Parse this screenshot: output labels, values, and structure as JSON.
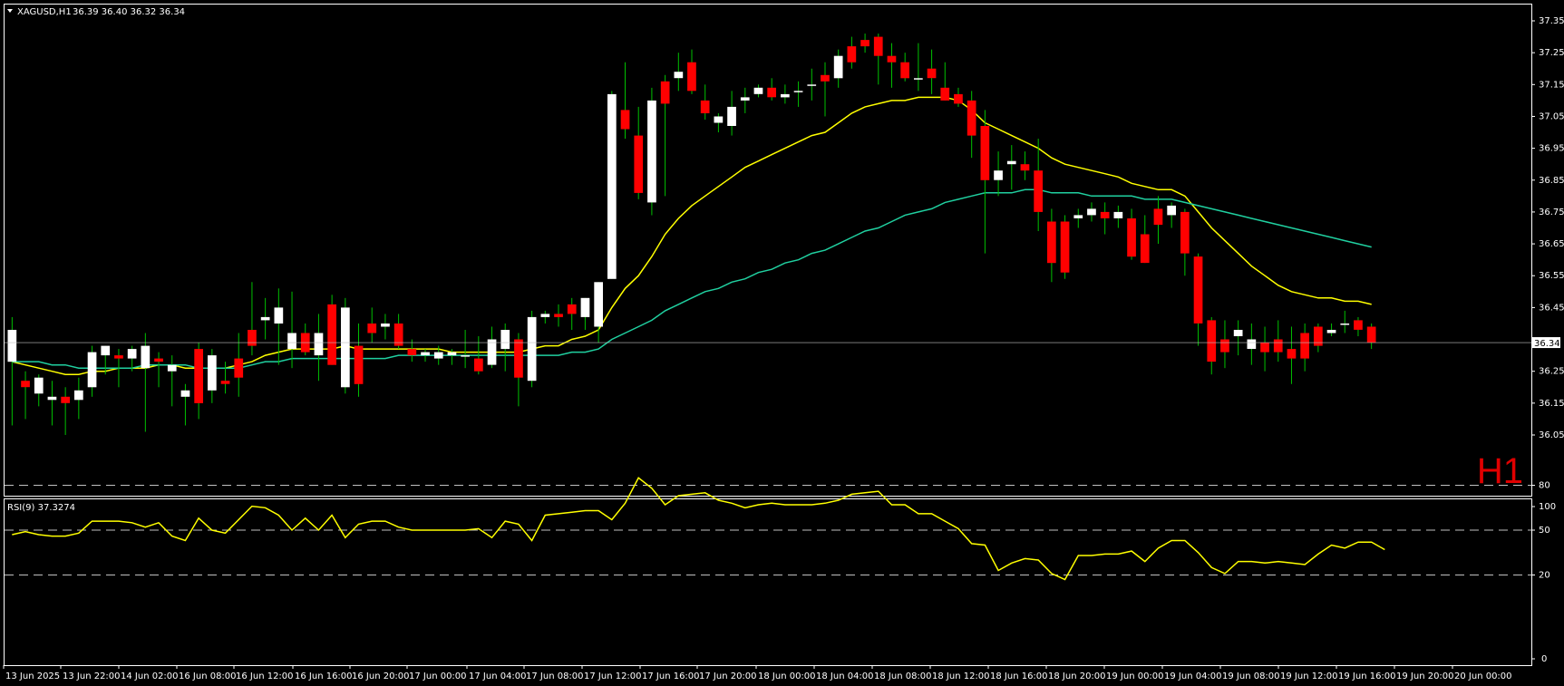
{
  "header": {
    "symbol": "XAGUSD,H1",
    "ohlc": "36.39 36.40 36.32 36.34"
  },
  "timeframe_watermark": "H1",
  "rsi_header": "RSI(9) 37.3274",
  "colors": {
    "background": "#000000",
    "frame": "#ffffff",
    "bull_candle": "#ffffff",
    "bear_candle": "#ff0000",
    "wick": "#00c000",
    "ma_fast": "#ffff00",
    "ma_slow": "#20d0a0",
    "rsi": "#ffff00",
    "watermark": "#e00000"
  },
  "chart_data": [
    {
      "type": "candlestick",
      "title": "XAGUSD,H1",
      "ylim": [
        36.0,
        37.4
      ],
      "yticks": [
        "37.35",
        "37.25",
        "37.15",
        "37.05",
        "36.95",
        "36.85",
        "36.75",
        "36.65",
        "36.55",
        "36.45",
        "36.34",
        "36.25",
        "36.15",
        "36.05"
      ],
      "last_price": "36.34",
      "xticks": [
        "13 Jun 2025",
        "13 Jun 22:00",
        "14 Jun 02:00",
        "16 Jun 08:00",
        "16 Jun 12:00",
        "16 Jun 16:00",
        "16 Jun 20:00",
        "17 Jun 00:00",
        "17 Jun 04:00",
        "17 Jun 08:00",
        "17 Jun 12:00",
        "17 Jun 16:00",
        "17 Jun 20:00",
        "18 Jun 00:00",
        "18 Jun 04:00",
        "18 Jun 08:00",
        "18 Jun 12:00",
        "18 Jun 16:00",
        "18 Jun 20:00",
        "19 Jun 00:00",
        "19 Jun 04:00",
        "19 Jun 08:00",
        "19 Jun 12:00",
        "19 Jun 16:00",
        "19 Jun 20:00",
        "20 Jun 00:00"
      ],
      "candles": [
        [
          36.28,
          36.42,
          36.08,
          36.38
        ],
        [
          36.22,
          36.25,
          36.1,
          36.2
        ],
        [
          36.18,
          36.24,
          36.14,
          36.23
        ],
        [
          36.16,
          36.22,
          36.08,
          36.17
        ],
        [
          36.17,
          36.2,
          36.05,
          36.15
        ],
        [
          36.16,
          36.23,
          36.1,
          36.19
        ],
        [
          36.2,
          36.33,
          36.17,
          36.31
        ],
        [
          36.3,
          36.33,
          36.24,
          36.33
        ],
        [
          36.3,
          36.32,
          36.2,
          36.29
        ],
        [
          36.29,
          36.33,
          36.25,
          36.32
        ],
        [
          36.26,
          36.37,
          36.06,
          36.33
        ],
        [
          36.29,
          36.31,
          36.2,
          36.28
        ],
        [
          36.25,
          36.3,
          36.14,
          36.27
        ],
        [
          36.17,
          36.21,
          36.08,
          36.19
        ],
        [
          36.32,
          36.34,
          36.1,
          36.15
        ],
        [
          36.19,
          36.32,
          36.15,
          36.3
        ],
        [
          36.22,
          36.28,
          36.18,
          36.21
        ],
        [
          36.29,
          36.37,
          36.17,
          36.23
        ],
        [
          36.38,
          36.53,
          36.3,
          36.33
        ],
        [
          36.41,
          36.48,
          36.35,
          36.42
        ],
        [
          36.4,
          36.51,
          36.27,
          36.45
        ],
        [
          36.32,
          36.5,
          36.26,
          36.37
        ],
        [
          36.37,
          36.4,
          36.3,
          36.31
        ],
        [
          36.3,
          36.43,
          36.22,
          36.37
        ],
        [
          36.46,
          36.49,
          36.27,
          36.27
        ],
        [
          36.2,
          36.48,
          36.18,
          36.45
        ],
        [
          36.33,
          36.4,
          36.17,
          36.21
        ],
        [
          36.4,
          36.45,
          36.34,
          36.37
        ],
        [
          36.39,
          36.43,
          36.35,
          36.4
        ],
        [
          36.4,
          36.43,
          36.32,
          36.33
        ],
        [
          36.32,
          36.35,
          36.28,
          36.3
        ],
        [
          36.3,
          36.32,
          36.28,
          36.31
        ],
        [
          36.29,
          36.33,
          36.27,
          36.31
        ],
        [
          36.3,
          36.32,
          36.27,
          36.31
        ],
        [
          36.3,
          36.38,
          36.26,
          36.3
        ],
        [
          36.29,
          36.36,
          36.24,
          36.25
        ],
        [
          36.27,
          36.39,
          36.26,
          36.35
        ],
        [
          36.32,
          36.4,
          36.25,
          36.38
        ],
        [
          36.35,
          36.37,
          36.14,
          36.23
        ],
        [
          36.22,
          36.44,
          36.2,
          36.42
        ],
        [
          36.42,
          36.44,
          36.4,
          36.43
        ],
        [
          36.43,
          36.46,
          36.39,
          36.42
        ],
        [
          36.46,
          36.48,
          36.38,
          36.43
        ],
        [
          36.42,
          36.48,
          36.38,
          36.48
        ],
        [
          36.39,
          36.53,
          36.34,
          36.53
        ],
        [
          36.54,
          37.13,
          36.54,
          37.12
        ],
        [
          37.07,
          37.22,
          36.98,
          37.01
        ],
        [
          36.99,
          37.08,
          36.79,
          36.81
        ],
        [
          36.78,
          37.14,
          36.74,
          37.1
        ],
        [
          37.16,
          37.18,
          36.8,
          37.09
        ],
        [
          37.17,
          37.25,
          37.13,
          37.19
        ],
        [
          37.22,
          37.26,
          37.12,
          37.13
        ],
        [
          37.1,
          37.15,
          37.04,
          37.06
        ],
        [
          37.03,
          37.06,
          37.0,
          37.05
        ],
        [
          37.02,
          37.13,
          36.99,
          37.08
        ],
        [
          37.1,
          37.14,
          37.06,
          37.11
        ],
        [
          37.12,
          37.15,
          37.11,
          37.14
        ],
        [
          37.14,
          37.17,
          37.1,
          37.11
        ],
        [
          37.11,
          37.15,
          37.09,
          37.12
        ],
        [
          37.13,
          37.16,
          37.08,
          37.13
        ],
        [
          37.15,
          37.2,
          37.1,
          37.15
        ],
        [
          37.18,
          37.22,
          37.05,
          37.16
        ],
        [
          37.17,
          37.26,
          37.14,
          37.24
        ],
        [
          37.27,
          37.3,
          37.2,
          37.22
        ],
        [
          37.29,
          37.31,
          37.25,
          37.27
        ],
        [
          37.3,
          37.31,
          37.15,
          37.24
        ],
        [
          37.24,
          37.28,
          37.14,
          37.22
        ],
        [
          37.22,
          37.25,
          37.16,
          37.17
        ],
        [
          37.17,
          37.28,
          37.13,
          37.17
        ],
        [
          37.2,
          37.26,
          37.12,
          37.17
        ],
        [
          37.14,
          37.22,
          37.1,
          37.1
        ],
        [
          37.12,
          37.14,
          37.08,
          37.09
        ],
        [
          37.1,
          37.13,
          36.92,
          36.99
        ],
        [
          37.02,
          37.07,
          36.62,
          36.85
        ],
        [
          36.85,
          36.94,
          36.8,
          36.88
        ],
        [
          36.9,
          36.96,
          36.82,
          36.91
        ],
        [
          36.9,
          36.94,
          36.85,
          36.88
        ],
        [
          36.88,
          36.98,
          36.69,
          36.75
        ],
        [
          36.72,
          36.76,
          36.53,
          36.59
        ],
        [
          36.72,
          36.74,
          36.54,
          36.56
        ],
        [
          36.73,
          36.76,
          36.7,
          36.74
        ],
        [
          36.74,
          36.78,
          36.72,
          36.76
        ],
        [
          36.75,
          36.78,
          36.68,
          36.73
        ],
        [
          36.73,
          36.77,
          36.7,
          36.75
        ],
        [
          36.73,
          36.76,
          36.6,
          36.61
        ],
        [
          36.68,
          36.74,
          36.59,
          36.59
        ],
        [
          36.76,
          36.8,
          36.65,
          36.71
        ],
        [
          36.74,
          36.78,
          36.7,
          36.77
        ],
        [
          36.75,
          36.76,
          36.55,
          36.62
        ],
        [
          36.61,
          36.62,
          36.33,
          36.4
        ],
        [
          36.41,
          36.42,
          36.24,
          36.28
        ],
        [
          36.35,
          36.41,
          36.26,
          36.31
        ],
        [
          36.36,
          36.41,
          36.3,
          36.38
        ],
        [
          36.32,
          36.4,
          36.27,
          36.35
        ],
        [
          36.34,
          36.39,
          36.25,
          36.31
        ],
        [
          36.35,
          36.41,
          36.28,
          36.31
        ],
        [
          36.32,
          36.39,
          36.21,
          36.29
        ],
        [
          36.37,
          36.4,
          36.25,
          36.29
        ],
        [
          36.39,
          36.4,
          36.31,
          36.33
        ],
        [
          36.37,
          36.4,
          36.36,
          36.38
        ],
        [
          36.4,
          36.44,
          36.37,
          36.4
        ],
        [
          36.41,
          36.42,
          36.36,
          36.38
        ],
        [
          36.39,
          36.4,
          36.32,
          36.34
        ]
      ],
      "series": [
        {
          "name": "",
          "color": "#ffff00",
          "values": [
            36.28,
            36.27,
            36.26,
            36.25,
            36.24,
            36.24,
            36.25,
            36.25,
            36.26,
            36.26,
            36.26,
            36.27,
            36.27,
            36.26,
            36.26,
            36.26,
            36.26,
            36.27,
            36.28,
            36.3,
            36.31,
            36.32,
            36.32,
            36.32,
            36.32,
            36.33,
            36.32,
            36.32,
            36.32,
            36.32,
            36.32,
            36.32,
            36.32,
            36.31,
            36.31,
            36.31,
            36.31,
            36.31,
            36.31,
            36.32,
            36.33,
            36.33,
            36.35,
            36.36,
            36.38,
            36.45,
            36.51,
            36.55,
            36.61,
            36.68,
            36.73,
            36.77,
            36.8,
            36.83,
            36.86,
            36.89,
            36.91,
            36.93,
            36.95,
            36.97,
            36.99,
            37.0,
            37.03,
            37.06,
            37.08,
            37.09,
            37.1,
            37.1,
            37.11,
            37.11,
            37.11,
            37.1,
            37.07,
            37.03,
            37.01,
            36.99,
            36.97,
            36.95,
            36.92,
            36.9,
            36.89,
            36.88,
            36.87,
            36.86,
            36.84,
            36.83,
            36.82,
            36.82,
            36.8,
            36.75,
            36.7,
            36.66,
            36.62,
            36.58,
            36.55,
            36.52,
            36.5,
            36.49,
            36.48,
            36.48,
            36.47,
            36.47,
            36.46
          ]
        },
        {
          "name": "",
          "color": "#20d0a0",
          "values": [
            36.28,
            36.28,
            36.28,
            36.27,
            36.27,
            36.26,
            36.26,
            36.26,
            36.26,
            36.26,
            36.27,
            36.27,
            36.27,
            36.27,
            36.26,
            36.26,
            36.26,
            36.26,
            36.27,
            36.28,
            36.28,
            36.29,
            36.29,
            36.29,
            36.29,
            36.29,
            36.29,
            36.29,
            36.29,
            36.3,
            36.3,
            36.3,
            36.3,
            36.3,
            36.3,
            36.3,
            36.3,
            36.3,
            36.3,
            36.3,
            36.3,
            36.3,
            36.31,
            36.31,
            36.32,
            36.35,
            36.37,
            36.39,
            36.41,
            36.44,
            36.46,
            36.48,
            36.5,
            36.51,
            36.53,
            36.54,
            36.56,
            36.57,
            36.59,
            36.6,
            36.62,
            36.63,
            36.65,
            36.67,
            36.69,
            36.7,
            36.72,
            36.74,
            36.75,
            36.76,
            36.78,
            36.79,
            36.8,
            36.81,
            36.81,
            36.81,
            36.82,
            36.82,
            36.81,
            36.81,
            36.81,
            36.8,
            36.8,
            36.8,
            36.8,
            36.79,
            36.79,
            36.79,
            36.78,
            36.77,
            36.76,
            36.75,
            36.74,
            36.73,
            36.72,
            36.71,
            36.7,
            36.69,
            36.68,
            36.67,
            36.66,
            36.65,
            36.64
          ]
        }
      ]
    },
    {
      "type": "line",
      "title": "RSI(9) 37.3274",
      "ylim": [
        0,
        100
      ],
      "yticks": [
        "100",
        "80",
        "50",
        "20",
        "0"
      ],
      "levels": [
        80,
        50,
        20
      ],
      "series": [
        {
          "name": "RSI(9)",
          "color": "#ffff00",
          "values": [
            47,
            49,
            47,
            46,
            46,
            48,
            56,
            56,
            56,
            55,
            52,
            55,
            46,
            43,
            58,
            50,
            48,
            57,
            66,
            65,
            60,
            50,
            58,
            50,
            60,
            45,
            54,
            56,
            56,
            52,
            50,
            50,
            50,
            50,
            50,
            51,
            45,
            56,
            54,
            43,
            60,
            61,
            62,
            63,
            63,
            57,
            68,
            85,
            78,
            67,
            73,
            74,
            75,
            70,
            68,
            65,
            67,
            68,
            67,
            67,
            67,
            68,
            70,
            74,
            75,
            76,
            67,
            67,
            61,
            61,
            56,
            51,
            41,
            40,
            23,
            28,
            31,
            30,
            21,
            17,
            33,
            33,
            34,
            34,
            36,
            29,
            38,
            43,
            43,
            35,
            25,
            21,
            29,
            29,
            28,
            29,
            28,
            27,
            34,
            40,
            38,
            42,
            42,
            37
          ]
        }
      ]
    }
  ]
}
